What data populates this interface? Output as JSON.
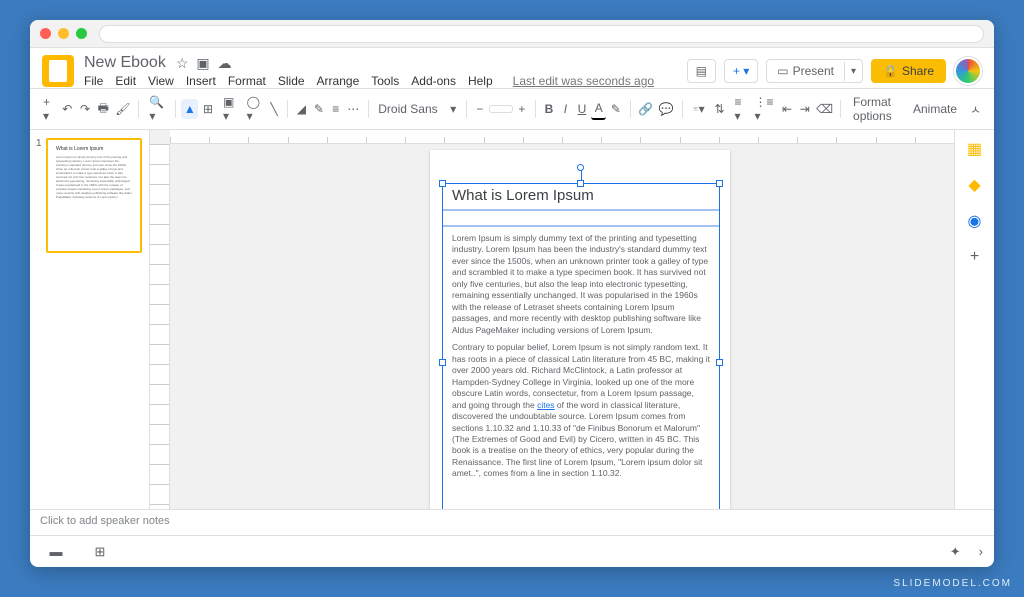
{
  "doc": {
    "title": "New Ebook",
    "edit_status": "Last edit was seconds ago"
  },
  "menubar": [
    "File",
    "Edit",
    "View",
    "Insert",
    "Format",
    "Slide",
    "Arrange",
    "Tools",
    "Add-ons",
    "Help"
  ],
  "buttons": {
    "present": "Present",
    "share": "Share",
    "format_options": "Format options",
    "animate": "Animate"
  },
  "toolbar": {
    "font": "Droid Sans",
    "bold": "B",
    "italic": "I",
    "underline": "U",
    "text": "A"
  },
  "thumb": {
    "num": "1"
  },
  "slide": {
    "title": "What is Lorem Ipsum",
    "p1": "Lorem Ipsum is simply dummy text of the printing and typesetting industry. Lorem Ipsum has been the industry's standard dummy text ever since the 1500s, when an unknown printer took a galley of type and scrambled it to make a type specimen book. It has survived not only five centuries, but also the leap into electronic typesetting, remaining essentially unchanged. It was popularised in the 1960s with the release of Letraset sheets containing Lorem Ipsum passages, and more recently with desktop publishing software like Aldus PageMaker including versions of Lorem Ipsum.",
    "p2a": "Contrary to popular belief, Lorem Ipsum is not simply random text. It has roots in a piece of classical Latin literature from 45 BC, making it over 2000 years old. Richard McClintock, a Latin professor at Hampden-Sydney College in Virginia, looked up one of the more obscure Latin words, consectetur, from a Lorem Ipsum passage, and going through the ",
    "cites": "cites",
    "p2b": " of the word in classical literature, discovered the undoubtable source. Lorem Ipsum comes from sections 1.10.32 and 1.10.33 of \"de Finibus Bonorum et Malorum\" (The Extremes of Good and Evil) by Cicero, written in 45 BC. This book is a treatise on the theory of ethics, very popular during the Renaissance. The first line of Lorem Ipsum, \"Lorem ipsum dolor sit amet..\", comes from a line in section 1.10.32."
  },
  "notes": {
    "placeholder": "Click to add speaker notes"
  },
  "colors": {
    "accent": "#fbbc04",
    "primary": "#1a73e8"
  },
  "watermark": "SLIDEMODEL.COM"
}
